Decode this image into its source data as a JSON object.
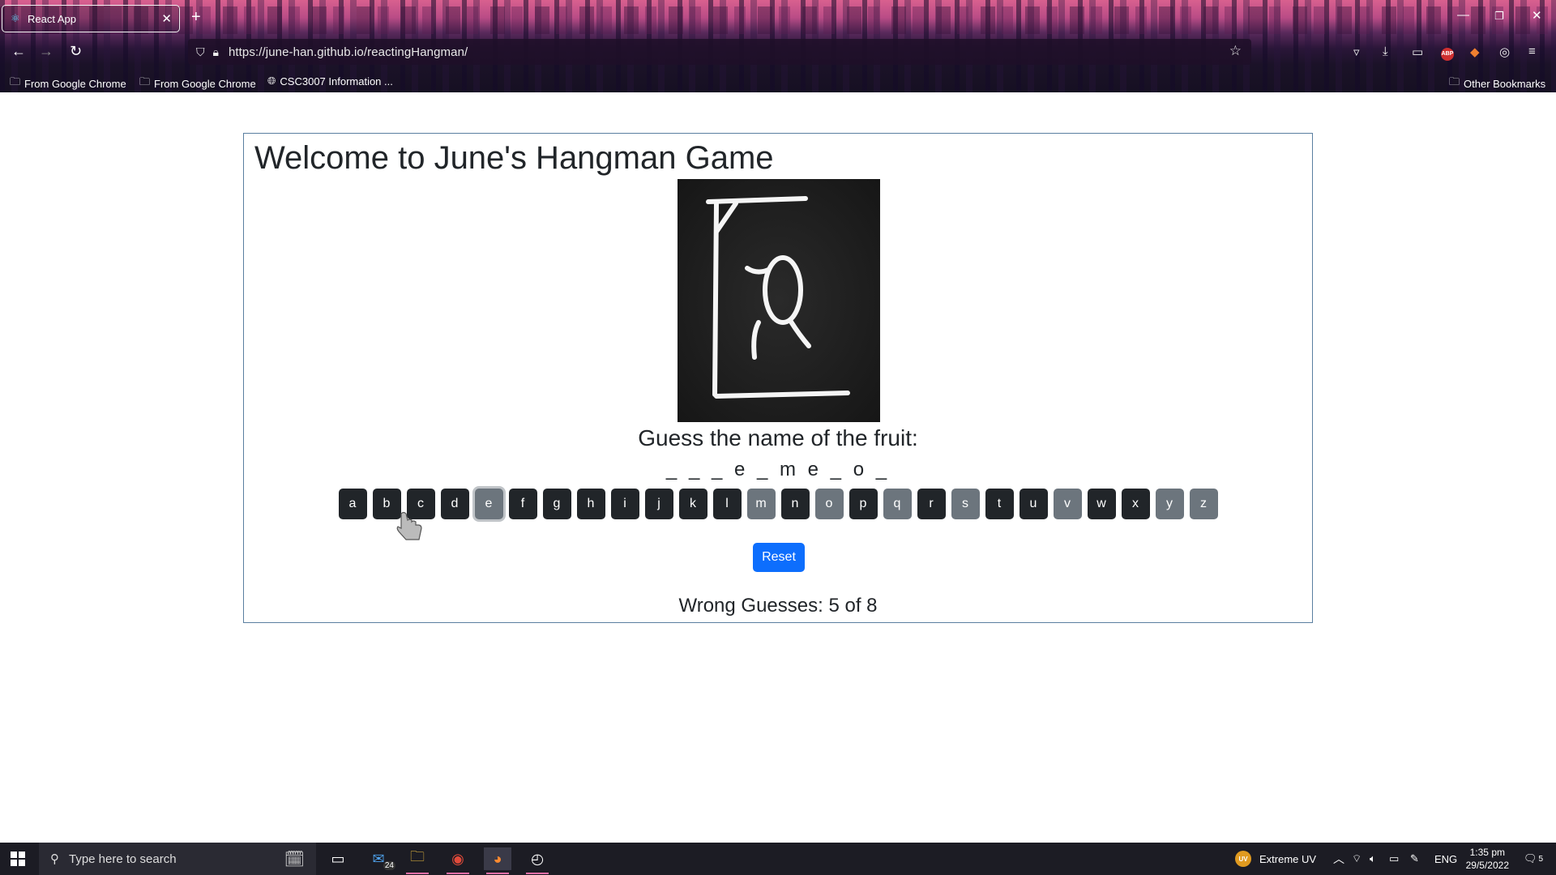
{
  "browser": {
    "tab_title": "React App",
    "url": "https://june-han.github.io/reactingHangman/",
    "bookmarks": [
      "From Google Chrome",
      "From Google Chrome",
      "CSC3007 Information ..."
    ],
    "other_bookmarks": "Other Bookmarks"
  },
  "game": {
    "title": "Welcome to June's Hangman Game",
    "prompt": "Guess the name of the fruit:",
    "word": "_ _ _ e _ m e _ o _",
    "letters": [
      {
        "label": "a",
        "state": "available"
      },
      {
        "label": "b",
        "state": "available"
      },
      {
        "label": "c",
        "state": "available"
      },
      {
        "label": "d",
        "state": "available"
      },
      {
        "label": "e",
        "state": "focused"
      },
      {
        "label": "f",
        "state": "available"
      },
      {
        "label": "g",
        "state": "available"
      },
      {
        "label": "h",
        "state": "available"
      },
      {
        "label": "i",
        "state": "available"
      },
      {
        "label": "j",
        "state": "available"
      },
      {
        "label": "k",
        "state": "available"
      },
      {
        "label": "l",
        "state": "available"
      },
      {
        "label": "m",
        "state": "used"
      },
      {
        "label": "n",
        "state": "available"
      },
      {
        "label": "o",
        "state": "used"
      },
      {
        "label": "p",
        "state": "available"
      },
      {
        "label": "q",
        "state": "used"
      },
      {
        "label": "r",
        "state": "available"
      },
      {
        "label": "s",
        "state": "used"
      },
      {
        "label": "t",
        "state": "available"
      },
      {
        "label": "u",
        "state": "available"
      },
      {
        "label": "v",
        "state": "used"
      },
      {
        "label": "w",
        "state": "available"
      },
      {
        "label": "x",
        "state": "available"
      },
      {
        "label": "y",
        "state": "used"
      },
      {
        "label": "z",
        "state": "used"
      }
    ],
    "reset_label": "Reset",
    "wrong_guesses": "Wrong Guesses: 5 of 8"
  },
  "taskbar": {
    "search_placeholder": "Type here to search",
    "mail_badge": "24",
    "weather": "Extreme UV",
    "language": "ENG",
    "time": "1:35 pm",
    "date": "29/5/2022",
    "notification_count": "5"
  },
  "colors": {
    "letter_available": "#212529",
    "letter_used": "#6c757d",
    "reset": "#0d6efd"
  }
}
